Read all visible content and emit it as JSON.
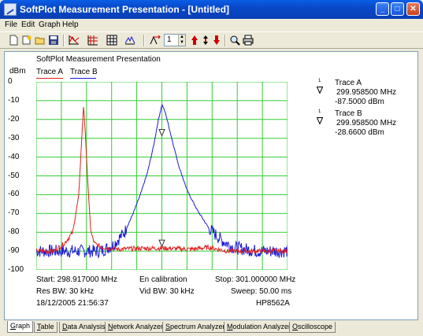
{
  "window": {
    "title": "SoftPlot Measurement Presentation - [Untitled]"
  },
  "menu": [
    "File",
    "Edit",
    "Graph",
    "Help"
  ],
  "toolbar": {
    "trace_number": "1"
  },
  "graph": {
    "title": "SoftPlot Measurement Presentation",
    "legend": [
      {
        "name": "Trace A",
        "color": "#e02020"
      },
      {
        "name": "Trace B",
        "color": "#1a1ad8"
      }
    ],
    "y_unit": "dBm",
    "y_ticks": [
      "0",
      "-10",
      "-20",
      "-30",
      "-40",
      "-50",
      "-60",
      "-70",
      "-80",
      "-90",
      "-100"
    ],
    "grid_color": "#33cc33",
    "footer": {
      "start": "Start: 298.917000 MHz",
      "status": "En calibration",
      "stop": "Stop: 301.000000 MHz",
      "res_bw": "Res BW: 30 kHz",
      "vid_bw": "Vid BW: 30 kHz",
      "sweep": "Sweep: 50.00 ms",
      "datetime": "18/12/2005 21:56:37",
      "instrument": "HP8562A"
    }
  },
  "markers": [
    {
      "trace": "Trace A",
      "freq": "299.958500 MHz",
      "level": "-87.5000 dBm"
    },
    {
      "trace": "Trace B",
      "freq": "299.958500 MHz",
      "level": "-28.6600 dBm"
    }
  ],
  "chart_data": {
    "type": "line",
    "ylabel": "dBm",
    "ylim": [
      -100,
      0
    ],
    "xlim": [
      298.917,
      301.0
    ],
    "grid": true,
    "series": [
      {
        "name": "Trace A",
        "color": "#e02020",
        "x": [
          298.917,
          299.06,
          299.15,
          299.22,
          299.27,
          299.29,
          299.31,
          299.33,
          299.35,
          299.37,
          299.4,
          299.46,
          299.6,
          299.8,
          300.0,
          300.2,
          300.35,
          300.5,
          300.7,
          301.0
        ],
        "y": [
          -90,
          -90,
          -86,
          -80,
          -60,
          -35,
          -12,
          -35,
          -60,
          -80,
          -86,
          -88,
          -89,
          -88.5,
          -88.5,
          -89,
          -88,
          -90,
          -90,
          -90
        ]
      },
      {
        "name": "Trace B",
        "color": "#1a1ad8",
        "x": [
          298.917,
          299.2,
          299.45,
          299.55,
          299.65,
          299.72,
          299.78,
          299.84,
          299.89,
          299.93,
          299.96,
          299.99,
          300.04,
          300.1,
          300.17,
          300.25,
          300.35,
          300.45,
          300.55,
          300.75,
          301.0
        ],
        "y": [
          -90,
          -90,
          -90,
          -87,
          -80,
          -70,
          -60,
          -48,
          -34,
          -20,
          -12,
          -17,
          -30,
          -45,
          -58,
          -68,
          -78,
          -84,
          -88,
          -90,
          -90
        ]
      }
    ]
  }
}
